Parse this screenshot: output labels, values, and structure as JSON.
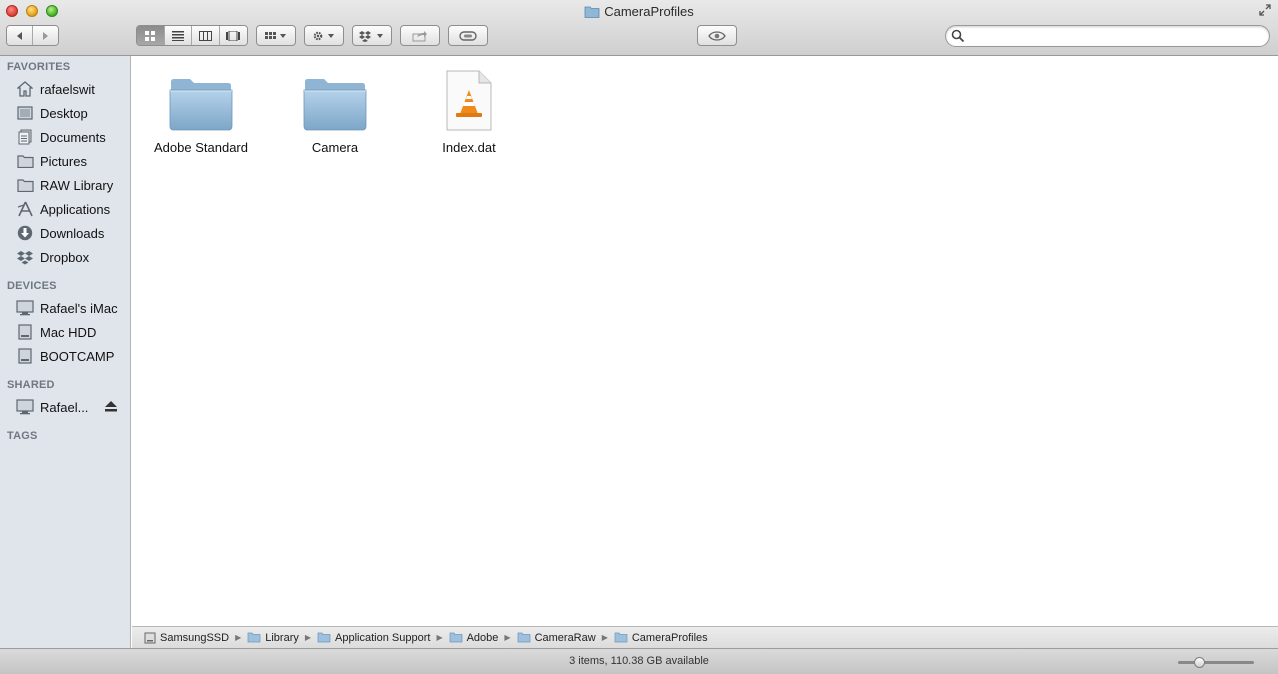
{
  "window": {
    "title": "CameraProfiles"
  },
  "toolbar": {
    "back_icon": "chevron-left",
    "forward_icon": "chevron-right",
    "view_modes": [
      "icon",
      "list",
      "column",
      "cover-flow"
    ],
    "active_view": "icon",
    "arrange_icon": "grid-arrange",
    "action_icon": "gear",
    "dropbox_icon": "dropbox",
    "share_icon": "share",
    "tags_icon": "tag",
    "quicklook_icon": "eye"
  },
  "search": {
    "placeholder": "",
    "value": ""
  },
  "sidebar": {
    "favorites_header": "FAVORITES",
    "favorites": [
      {
        "label": "rafaelswit",
        "icon": "home"
      },
      {
        "label": "Desktop",
        "icon": "desktop"
      },
      {
        "label": "Documents",
        "icon": "documents"
      },
      {
        "label": "Pictures",
        "icon": "folder"
      },
      {
        "label": "RAW Library",
        "icon": "folder"
      },
      {
        "label": "Applications",
        "icon": "applications"
      },
      {
        "label": "Downloads",
        "icon": "downloads"
      },
      {
        "label": "Dropbox",
        "icon": "dropbox"
      }
    ],
    "devices_header": "DEVICES",
    "devices": [
      {
        "label": "Rafael's iMac",
        "icon": "imac"
      },
      {
        "label": "Mac HDD",
        "icon": "disk"
      },
      {
        "label": "BOOTCAMP",
        "icon": "disk"
      }
    ],
    "shared_header": "SHARED",
    "shared": [
      {
        "label": "Rafael...",
        "icon": "network-computer"
      }
    ],
    "tags_header": "TAGS"
  },
  "files": [
    {
      "name": "Adobe Standard",
      "type": "folder"
    },
    {
      "name": "Camera",
      "type": "folder"
    },
    {
      "name": "Index.dat",
      "type": "vlc-document"
    }
  ],
  "path": [
    {
      "label": "SamsungSSD",
      "icon": "disk"
    },
    {
      "label": "Library",
      "icon": "folder"
    },
    {
      "label": "Application Support",
      "icon": "folder"
    },
    {
      "label": "Adobe",
      "icon": "folder"
    },
    {
      "label": "CameraRaw",
      "icon": "folder"
    },
    {
      "label": "CameraProfiles",
      "icon": "folder"
    }
  ],
  "status": {
    "text": "3 items, 110.38 GB available",
    "icon_size_fraction": 0.24
  },
  "colors": {
    "sidebar_bg": "#e0e5ec",
    "folder_blue": "#8fb7d8"
  }
}
